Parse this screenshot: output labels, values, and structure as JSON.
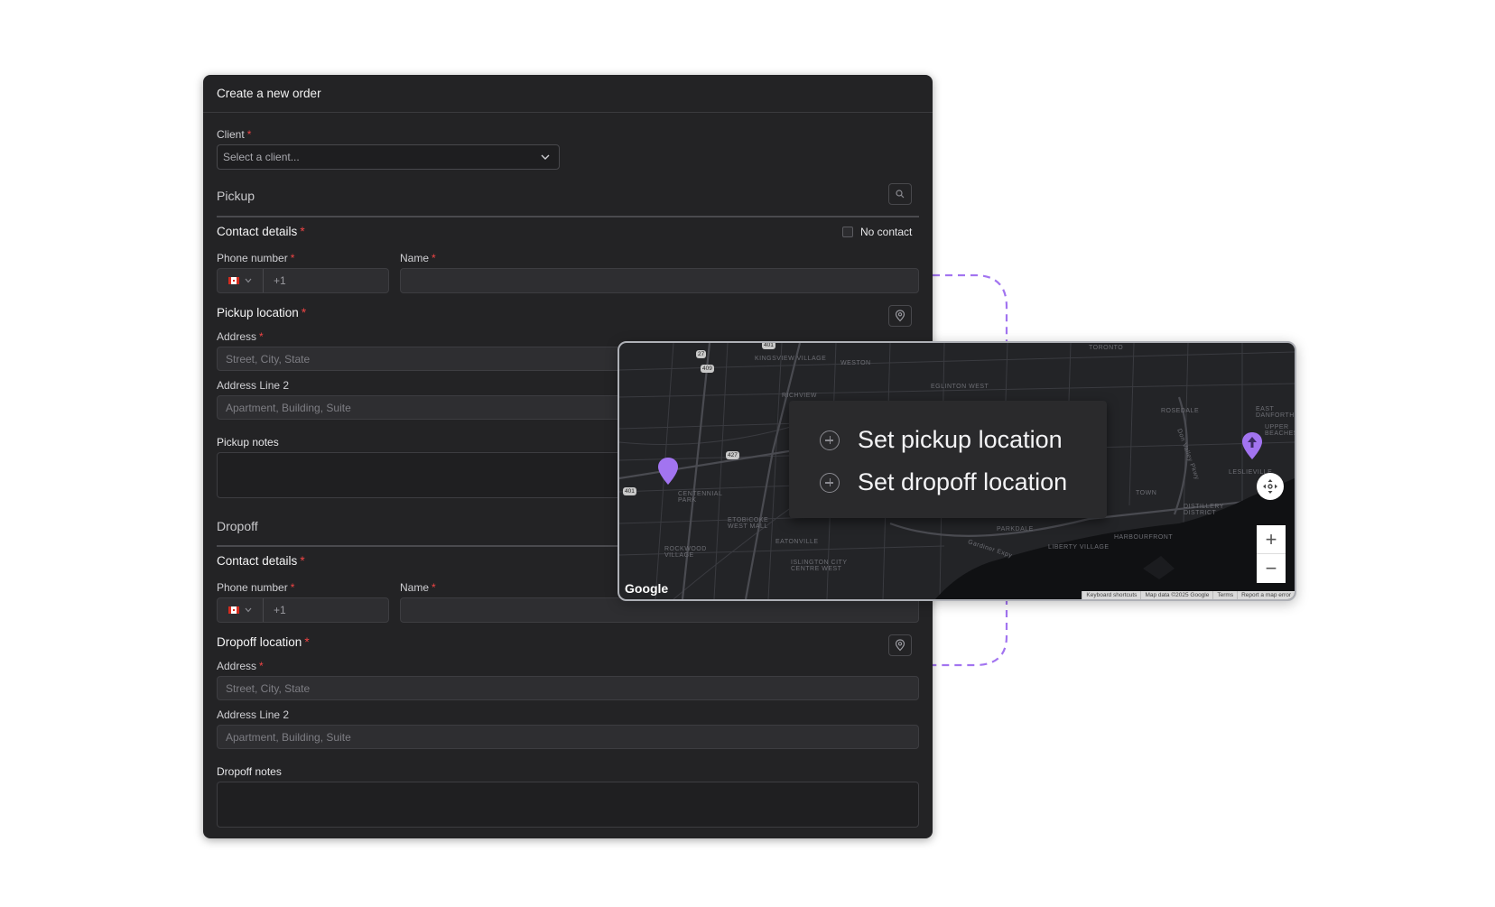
{
  "form": {
    "title": "Create a new order",
    "client_label": "Client",
    "client_placeholder": "Select a client...",
    "required_mark": "*",
    "pickup": {
      "section_title": "Pickup",
      "contact_title": "Contact details",
      "no_contact_label": "No contact",
      "phone_label": "Phone number",
      "phone_code": "+1",
      "name_label": "Name",
      "location_title": "Pickup location",
      "address_label": "Address",
      "address_placeholder": "Street, City, State",
      "address2_label": "Address Line 2",
      "address2_placeholder": "Apartment, Building, Suite",
      "notes_label": "Pickup notes"
    },
    "dropoff": {
      "section_title": "Dropoff",
      "contact_title": "Contact details",
      "phone_label": "Phone number",
      "phone_code": "+1",
      "name_label": "Name",
      "location_title": "Dropoff location",
      "address_label": "Address",
      "address_placeholder": "Street, City, State",
      "address2_label": "Address Line 2",
      "address2_placeholder": "Apartment, Building, Suite",
      "notes_label": "Dropoff notes"
    }
  },
  "map": {
    "popup": {
      "set_pickup": "Set pickup location",
      "set_dropoff": "Set dropoff location"
    },
    "labels": [
      "TORONTO",
      "KINGSVIEW VILLAGE",
      "WESTON",
      "EGLINTON WEST",
      "RICHVIEW",
      "CENTENNIAL PARK",
      "ETOBICOKE WEST MALL",
      "EATONVILLE",
      "ROCKWOOD VILLAGE",
      "ISLINGTON CITY CENTRE WEST",
      "PARKDALE",
      "LIBERTY VILLAGE",
      "HARBOURFRONT",
      "DISTILLERY DISTRICT",
      "ROSEDALE",
      "EAST DANFORTH",
      "UPPER BEACHES",
      "LESLIEVILLE",
      "Gardiner Expy",
      "Don Valley Pkwy",
      "TOWN"
    ],
    "shields": [
      "27",
      "409",
      "427",
      "401",
      "401"
    ],
    "google_logo": "Google",
    "attribution": [
      "Keyboard shortcuts",
      "Map data ©2025 Google",
      "Terms",
      "Report a map error"
    ],
    "zoom_in": "+",
    "zoom_out": "−",
    "marker_color": "#a274f0"
  },
  "colors": {
    "panel_bg": "#232325",
    "accent": "#a274f0",
    "required": "#ef4444"
  }
}
